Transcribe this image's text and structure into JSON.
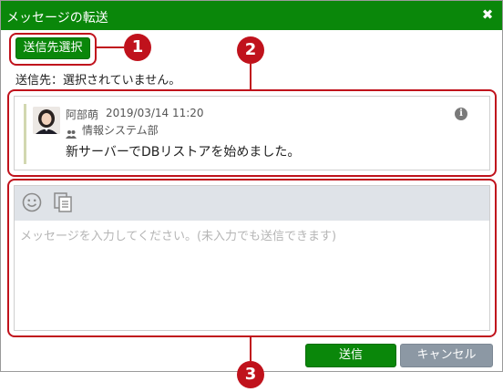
{
  "dialog": {
    "title": "メッセージの転送",
    "close_icon": "close-icon"
  },
  "select_recipient_label": "送信先選択",
  "recipient_status": "送信先：選択されていません。",
  "forwarded_message": {
    "author": "阿部萌",
    "timestamp": "2019/03/14 11:20",
    "department": "情報システム部",
    "text": "新サーバーでDBリストアを始めました。",
    "info_icon": "info-icon"
  },
  "compose": {
    "placeholder": "メッセージを入力してください。(未入力でも送信できます)",
    "emoji_icon": "smile-icon",
    "template_icon": "document-copy-icon"
  },
  "buttons": {
    "send": "送信",
    "cancel": "キャンセル"
  },
  "callouts": [
    "1",
    "2",
    "3"
  ],
  "colors": {
    "brand_green": "#0a870a",
    "callout_red": "#c0121c",
    "cancel_gray": "#8c98a4"
  }
}
